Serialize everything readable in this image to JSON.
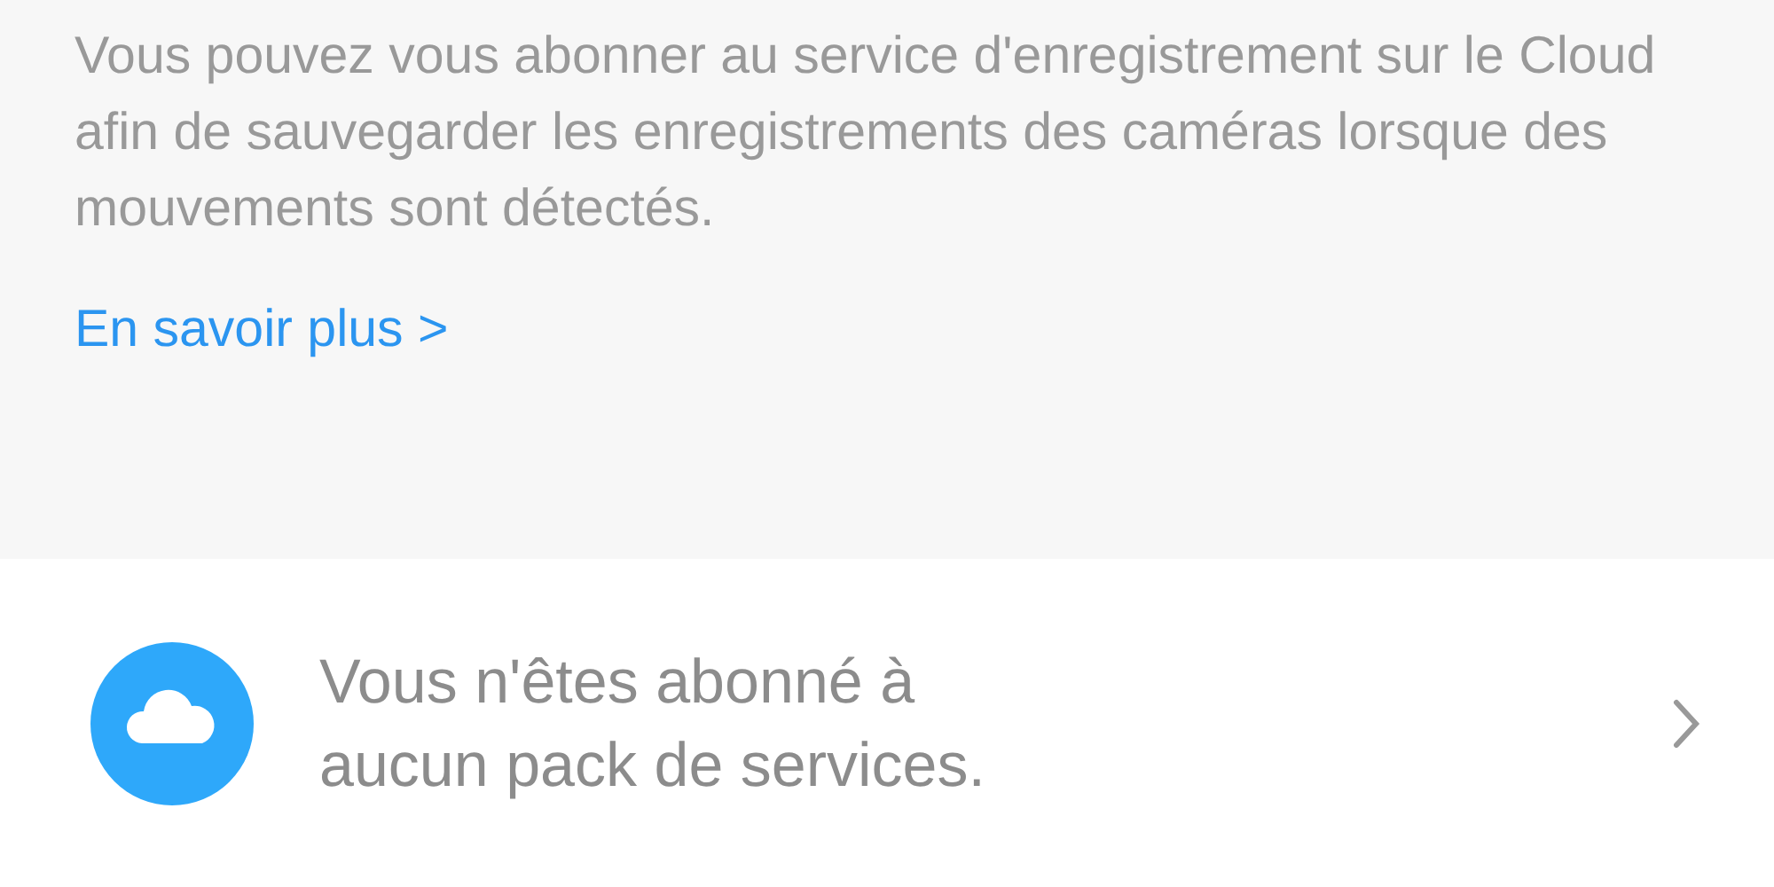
{
  "info": {
    "description": "Vous pouvez vous abonner au service d'enregistrement sur le Cloud afin de sauvegarder les enregistrements des caméras lorsque des mouvements sont détectés.",
    "link": "En savoir plus >"
  },
  "subscription": {
    "status": "Vous n'êtes abonné à aucun pack de services."
  }
}
